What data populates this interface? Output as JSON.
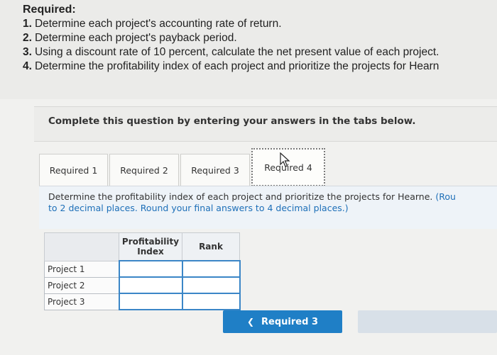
{
  "required": {
    "title": "Required:",
    "items": [
      {
        "num": "1.",
        "text": "Determine each project's accounting rate of return."
      },
      {
        "num": "2.",
        "text": "Determine each project's payback period."
      },
      {
        "num": "3.",
        "text": "Using a discount rate of 10 percent, calculate the net present value of each project."
      },
      {
        "num": "4.",
        "text": "Determine the profitability index of each project and prioritize the projects for Hearn"
      }
    ]
  },
  "complete_text": "Complete this question by entering your answers in the tabs below.",
  "tabs": [
    "Required 1",
    "Required 2",
    "Required 3",
    "Required 4"
  ],
  "instruction": {
    "main": "Determine the profitability index of each project and prioritize the projects for Hearne.",
    "note_line1": "(Rou",
    "note_line2": "to 2 decimal places. Round your final answers to 4 decimal places.)"
  },
  "table": {
    "headers": [
      "Profitability Index",
      "Rank"
    ],
    "rows": [
      "Project 1",
      "Project 2",
      "Project 3"
    ]
  },
  "back_button": "Required 3"
}
